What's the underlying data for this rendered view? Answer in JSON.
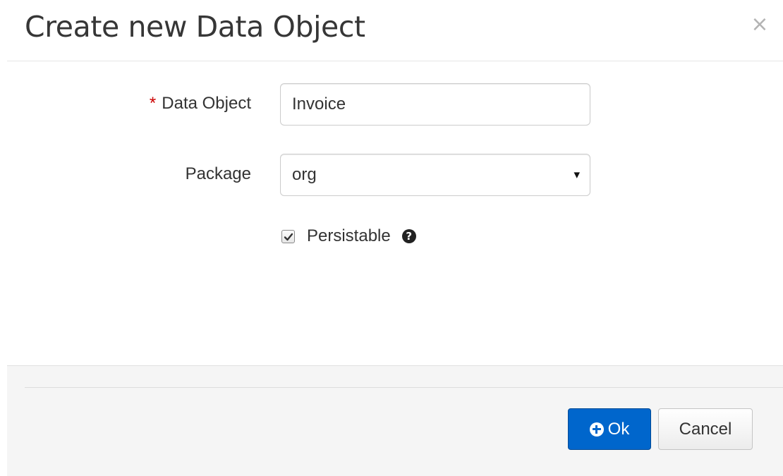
{
  "dialog": {
    "title": "Create new Data Object",
    "close_glyph": "×"
  },
  "form": {
    "data_object": {
      "label": "Data Object",
      "required_marker": "*",
      "value": "Invoice",
      "required": true
    },
    "package": {
      "label": "Package",
      "selected": "org",
      "caret_glyph": "▾"
    },
    "persistable": {
      "label": "Persistable",
      "checked": true,
      "help_glyph": "?"
    }
  },
  "footer": {
    "ok_label": "Ok",
    "cancel_label": "Cancel"
  },
  "colors": {
    "primary": "#0066cc",
    "required": "#cc0000",
    "footer_bg": "#f5f5f5"
  },
  "icons": {
    "close": "close-icon",
    "caret": "chevron-down-icon",
    "checkbox": "checkmark-icon",
    "help": "question-circle-icon",
    "ok": "plus-circle-icon"
  }
}
